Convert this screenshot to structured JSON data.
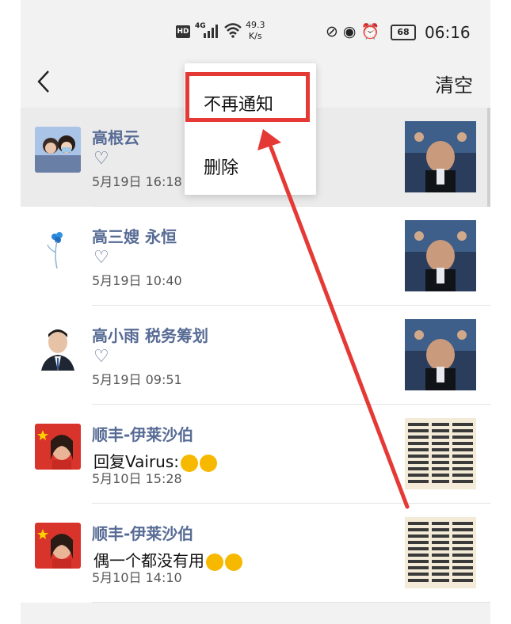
{
  "status_bar": {
    "hd": "HD",
    "network": "4G",
    "speed_value": "49.3",
    "speed_unit": "K/s",
    "battery": "68",
    "time": "06:16"
  },
  "nav": {
    "back_icon": "chevron-left-icon",
    "clear_label": "清空"
  },
  "menu": {
    "items": [
      "不再通知",
      "删除"
    ],
    "highlight_color": "#e53935"
  },
  "notifications": [
    {
      "name": "高根云",
      "content": "heart",
      "time": "5月19日 16:18"
    },
    {
      "name": "高三嫂 永恒",
      "content": "heart",
      "time": "5月19日 10:40"
    },
    {
      "name": "高小雨 税务筹划",
      "content": "heart",
      "time": "5月19日 09:51"
    },
    {
      "name": "顺丰-伊莱沙伯",
      "reply_text": "回复Vairus:",
      "time": "5月10日 15:28"
    },
    {
      "name": "顺丰-伊莱沙伯",
      "reply_text": "偶一个都没有用",
      "time": "5月10日 14:10"
    }
  ],
  "colors": {
    "name_link": "#576b95",
    "arrow": "#e53935"
  }
}
